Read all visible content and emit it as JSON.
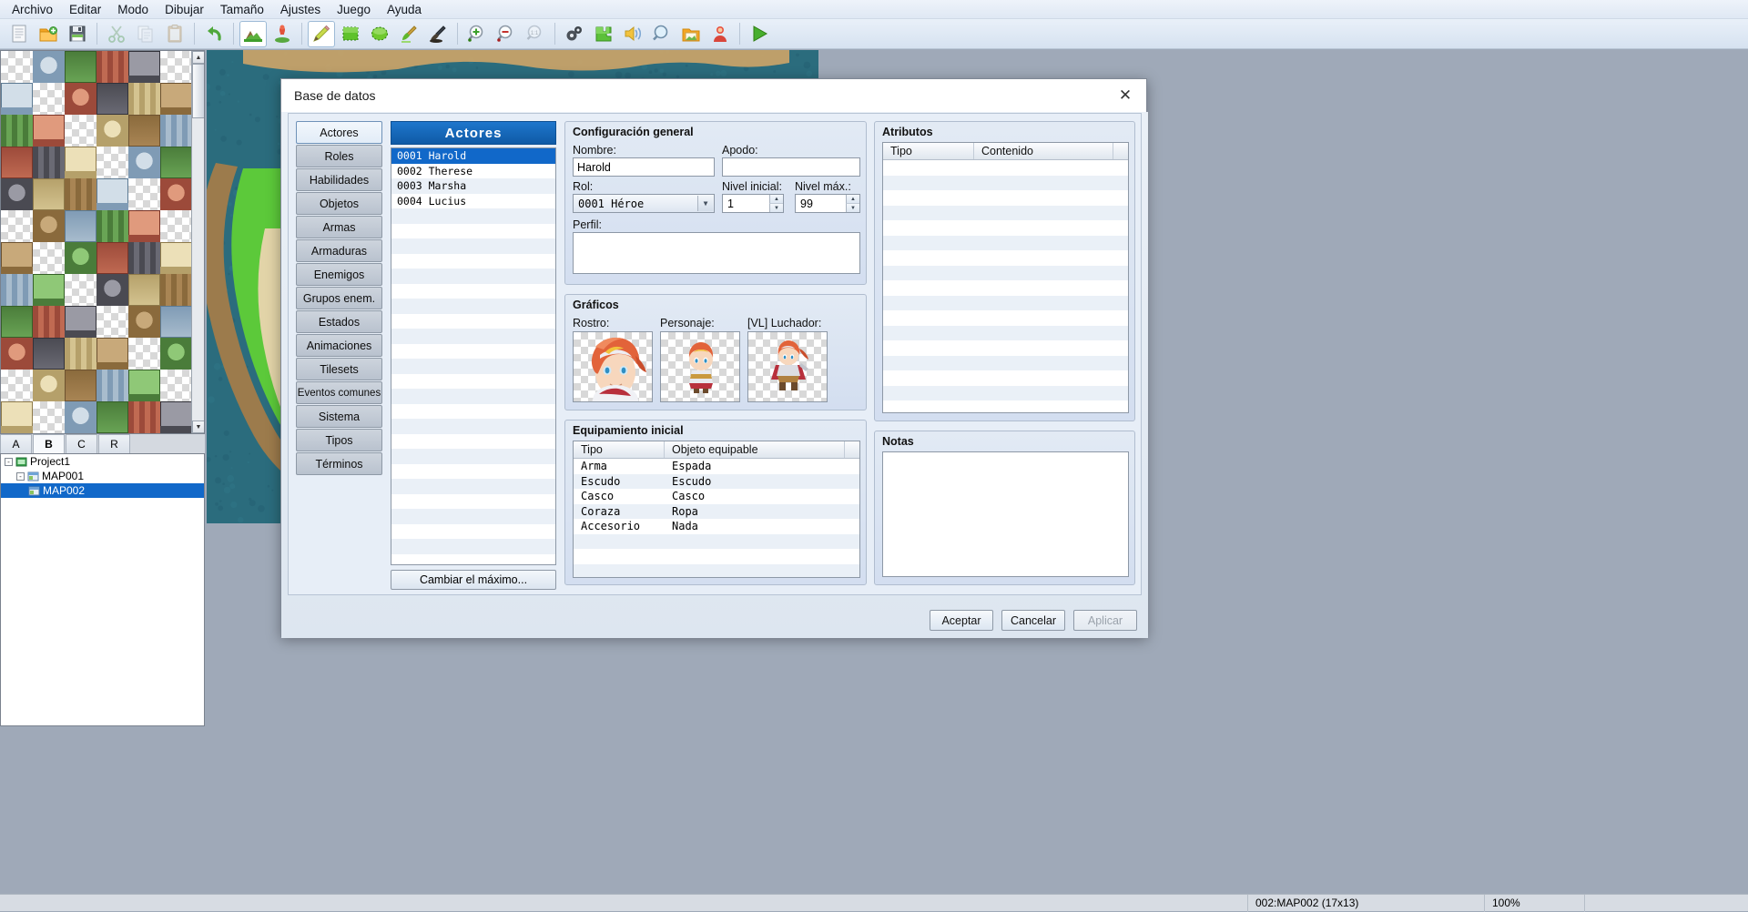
{
  "menubar": {
    "items": [
      {
        "label": "Archivo"
      },
      {
        "label": "Editar"
      },
      {
        "label": "Modo"
      },
      {
        "label": "Dibujar"
      },
      {
        "label": "Tamaño"
      },
      {
        "label": "Ajustes"
      },
      {
        "label": "Juego"
      },
      {
        "label": "Ayuda"
      }
    ]
  },
  "toolbar": {
    "buttons": [
      {
        "name": "new-project-icon",
        "icon": "document"
      },
      {
        "name": "open-project-icon",
        "icon": "folder"
      },
      {
        "name": "save-project-icon",
        "icon": "floppy"
      },
      {
        "name": "cut-icon",
        "icon": "scissors",
        "dim": true
      },
      {
        "name": "copy-icon",
        "icon": "copy",
        "dim": true
      },
      {
        "name": "paste-icon",
        "icon": "clipboard",
        "dim": true
      },
      {
        "name": "undo-icon",
        "icon": "undo"
      },
      {
        "name": "map-mode-icon",
        "icon": "map",
        "active": true
      },
      {
        "name": "event-mode-icon",
        "icon": "event"
      },
      {
        "name": "pencil-tool-icon",
        "icon": "pencil",
        "active": true
      },
      {
        "name": "rectangle-tool-icon",
        "icon": "rect"
      },
      {
        "name": "ellipse-tool-icon",
        "icon": "ellipse"
      },
      {
        "name": "flood-fill-icon",
        "icon": "fill"
      },
      {
        "name": "shadow-pen-icon",
        "icon": "shadow"
      },
      {
        "name": "zoom-in-icon",
        "icon": "zoomin"
      },
      {
        "name": "zoom-out-icon",
        "icon": "zoomout"
      },
      {
        "name": "zoom-actual-icon",
        "icon": "zoom11",
        "dim": true
      },
      {
        "name": "database-icon",
        "icon": "gears"
      },
      {
        "name": "plugin-manager-icon",
        "icon": "puzzle"
      },
      {
        "name": "sound-test-icon",
        "icon": "speaker"
      },
      {
        "name": "event-search-icon",
        "icon": "search"
      },
      {
        "name": "resource-manager-icon",
        "icon": "folderimg"
      },
      {
        "name": "character-generator-icon",
        "icon": "person"
      },
      {
        "name": "playtest-icon",
        "icon": "play"
      }
    ]
  },
  "tile_tabs": {
    "items": [
      "A",
      "B",
      "C",
      "R"
    ],
    "selected": "B"
  },
  "map_tree": {
    "nodes": [
      {
        "label": "Project1",
        "depth": 0,
        "icon": "project-icon",
        "expander": "-",
        "selected": false
      },
      {
        "label": "MAP001",
        "depth": 1,
        "icon": "map-icon",
        "expander": "-",
        "selected": false
      },
      {
        "label": "MAP002",
        "depth": 2,
        "icon": "map-icon",
        "expander": "",
        "selected": true
      }
    ]
  },
  "statusbar": {
    "map_info": "002:MAP002  (17x13)",
    "zoom": "100%"
  },
  "dialog": {
    "title": "Base de datos",
    "close_label": "✕",
    "tabs": [
      {
        "label": "Actores",
        "selected": true
      },
      {
        "label": "Roles",
        "selected": false
      },
      {
        "label": "Habilidades",
        "selected": false
      },
      {
        "label": "Objetos",
        "selected": false
      },
      {
        "label": "Armas",
        "selected": false
      },
      {
        "label": "Armaduras",
        "selected": false
      },
      {
        "label": "Enemigos",
        "selected": false
      },
      {
        "label": "Grupos enem.",
        "selected": false
      },
      {
        "label": "Estados",
        "selected": false
      },
      {
        "label": "Animaciones",
        "selected": false
      },
      {
        "label": "Tilesets",
        "selected": false
      },
      {
        "label": "Eventos comunes",
        "selected": false
      },
      {
        "label": "Sistema",
        "selected": false
      },
      {
        "label": "Tipos",
        "selected": false
      },
      {
        "label": "Términos",
        "selected": false
      }
    ],
    "list": {
      "header": "Actores",
      "items": [
        {
          "label": "0001 Harold",
          "selected": true
        },
        {
          "label": "0002 Therese",
          "selected": false
        },
        {
          "label": "0003 Marsha",
          "selected": false
        },
        {
          "label": "0004 Lucius",
          "selected": false
        }
      ],
      "max_button": "Cambiar el máximo..."
    },
    "general": {
      "title": "Configuración general",
      "name_label": "Nombre:",
      "name_value": "Harold",
      "nickname_label": "Apodo:",
      "nickname_value": "",
      "class_label": "Rol:",
      "class_value": "0001 Héroe",
      "initial_level_label": "Nivel inicial:",
      "initial_level_value": "1",
      "max_level_label": "Nivel máx.:",
      "max_level_value": "99",
      "profile_label": "Perfil:",
      "profile_value": ""
    },
    "graphics": {
      "title": "Gráficos",
      "face_label": "Rostro:",
      "character_label": "Personaje:",
      "battler_label": "[VL] Luchador:"
    },
    "equipment": {
      "title": "Equipamiento inicial",
      "columns": [
        "Tipo",
        "Objeto equipable"
      ],
      "rows": [
        {
          "type": "Arma",
          "item": "Espada"
        },
        {
          "type": "Escudo",
          "item": "Escudo"
        },
        {
          "type": "Casco",
          "item": "Casco"
        },
        {
          "type": "Coraza",
          "item": "Ropa"
        },
        {
          "type": "Accesorio",
          "item": "Nada"
        }
      ]
    },
    "traits": {
      "title": "Atributos",
      "columns": [
        "Tipo",
        "Contenido"
      ],
      "rows": []
    },
    "notes": {
      "title": "Notas",
      "value": ""
    },
    "footer": {
      "ok": "Aceptar",
      "cancel": "Cancelar",
      "apply": "Aplicar"
    }
  },
  "colors": {
    "accent_blue": "#1168c9",
    "header_blue": "#0f5aa6",
    "dialog_bg": "#e7eef7",
    "water": "#2b6c7d"
  }
}
